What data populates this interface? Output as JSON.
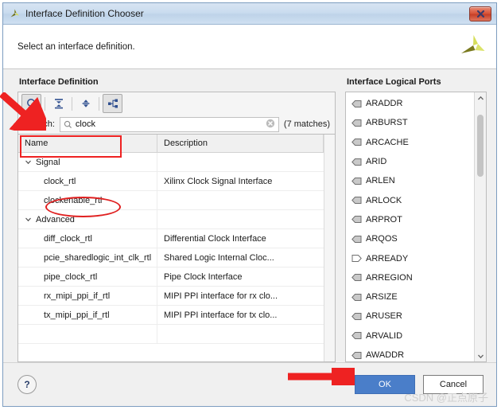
{
  "window": {
    "title": "Interface Definition Chooser",
    "title_icon": "xilinx-vivado-icon",
    "close_label": "close-icon"
  },
  "header": {
    "instruction": "Select an interface definition.",
    "logo": "xilinx-logo"
  },
  "left_panel": {
    "title": "Interface Definition",
    "toolbar": [
      {
        "name": "search-toggle-button",
        "icon": "magnifier-icon",
        "pressed": true
      },
      {
        "name": "collapse-all-button",
        "icon": "collapse-all-icon",
        "pressed": false
      },
      {
        "name": "expand-all-button",
        "icon": "expand-all-icon",
        "pressed": false
      },
      {
        "name": "tree-view-button",
        "icon": "hierarchy-icon",
        "pressed": false
      }
    ],
    "search": {
      "label": "Search:",
      "label_mnemonic": "S",
      "value": "clock",
      "placeholder": "",
      "field_icon": "search-small-icon",
      "clear_icon": "clear-circle-icon",
      "matches": "(7 matches)"
    },
    "columns": [
      "Name",
      "Description"
    ],
    "rows": [
      {
        "type": "group",
        "name": "Signal",
        "description": "",
        "expanded": true
      },
      {
        "type": "item",
        "name": "clock_rtl",
        "description": "Xilinx Clock Signal Interface"
      },
      {
        "type": "item",
        "name": "clockenable_rtl",
        "description": ""
      },
      {
        "type": "group",
        "name": "Advanced",
        "description": "",
        "expanded": true
      },
      {
        "type": "item",
        "name": "diff_clock_rtl",
        "description": "Differential Clock Interface"
      },
      {
        "type": "item",
        "name": "pcie_sharedlogic_int_clk_rtl",
        "description": "Shared Logic Internal Cloc..."
      },
      {
        "type": "item",
        "name": "pipe_clock_rtl",
        "description": "Pipe Clock Interface"
      },
      {
        "type": "item",
        "name": "rx_mipi_ppi_if_rtl",
        "description": "MIPI PPI interface for rx clo..."
      },
      {
        "type": "item",
        "name": "tx_mipi_ppi_if_rtl",
        "description": "MIPI PPI interface for tx clo..."
      }
    ]
  },
  "right_panel": {
    "title": "Interface Logical Ports",
    "ports": [
      {
        "name": "ARADDR",
        "direction": "in"
      },
      {
        "name": "ARBURST",
        "direction": "in"
      },
      {
        "name": "ARCACHE",
        "direction": "in"
      },
      {
        "name": "ARID",
        "direction": "in"
      },
      {
        "name": "ARLEN",
        "direction": "in"
      },
      {
        "name": "ARLOCK",
        "direction": "in"
      },
      {
        "name": "ARPROT",
        "direction": "in"
      },
      {
        "name": "ARQOS",
        "direction": "in"
      },
      {
        "name": "ARREADY",
        "direction": "out"
      },
      {
        "name": "ARREGION",
        "direction": "in"
      },
      {
        "name": "ARSIZE",
        "direction": "in"
      },
      {
        "name": "ARUSER",
        "direction": "in"
      },
      {
        "name": "ARVALID",
        "direction": "in"
      },
      {
        "name": "AWADDR",
        "direction": "in"
      }
    ],
    "scrollbar": {
      "up_icon": "chevron-up-icon",
      "down_icon": "chevron-down-icon"
    }
  },
  "footer": {
    "help_label": "?",
    "ok_label": "OK",
    "cancel_label": "Cancel",
    "watermark": "CSDN @正点原子"
  },
  "annotations": {
    "arrow_to_toolbar": "red-arrow-annotation",
    "rect_around_search": "red-rectangle-annotation",
    "ellipse_around_clock_rtl": "red-ellipse-annotation",
    "arrow_to_ok": "red-arrow-annotation"
  },
  "colors": {
    "accent_button": "#4a7ec9",
    "annotation_red": "#ee2222",
    "titlebar": "#cadcef",
    "close_button": "#d9553a"
  }
}
